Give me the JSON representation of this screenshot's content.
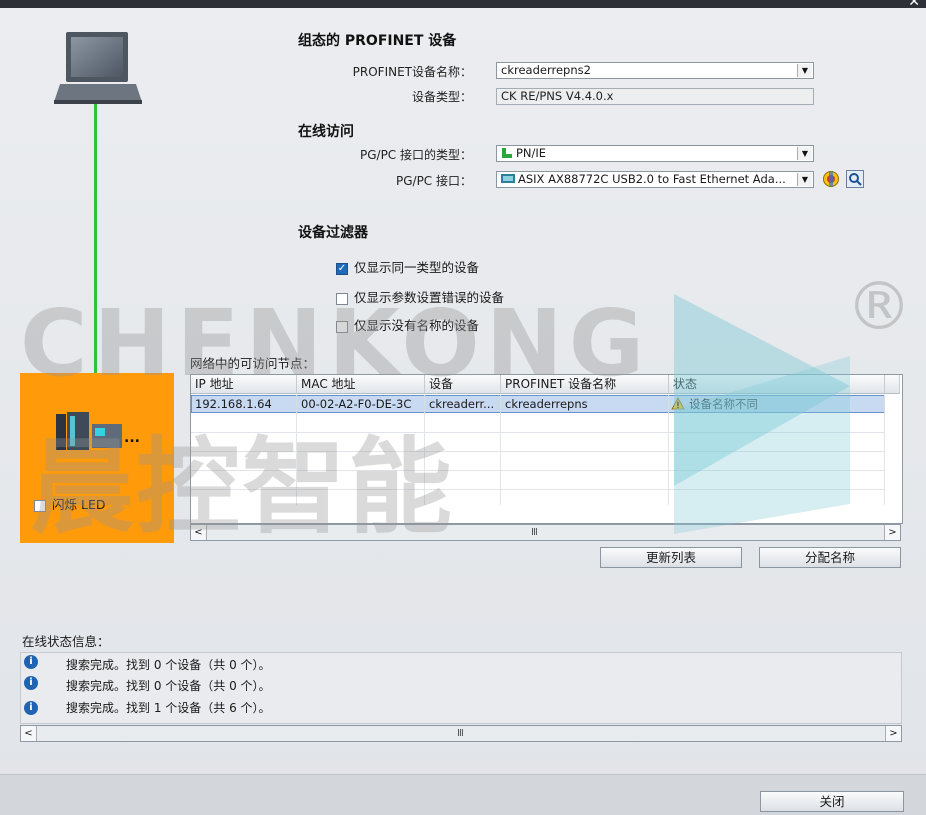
{
  "window": {
    "close_glyph": "✕"
  },
  "configured_device": {
    "heading": "组态的 PROFINET 设备",
    "name_label": "PROFINET设备名称：",
    "name_value": "ckreaderrepns2",
    "type_label": "设备类型：",
    "type_value": "CK RE/PNS V4.4.0.x"
  },
  "online_access": {
    "heading": "在线访问",
    "pgpc_type_label": "PG/PC 接口的类型：",
    "pgpc_type_value": "PN/IE",
    "pgpc_iface_label": "PG/PC 接口：",
    "pgpc_iface_value": "ASIX AX88772C USB2.0 to Fast Ethernet Ada..."
  },
  "filter": {
    "heading": "设备过滤器",
    "options": [
      {
        "label": "仅显示同一类型的设备",
        "checked": true
      },
      {
        "label": "仅显示参数设置错误的设备",
        "checked": false
      },
      {
        "label": "仅显示没有名称的设备",
        "checked": false
      }
    ]
  },
  "nodes": {
    "caption": "网络中的可访问节点：",
    "columns": [
      "IP 地址",
      "MAC 地址",
      "设备",
      "PROFINET 设备名称",
      "状态"
    ],
    "rows": [
      [
        "192.168.1.64",
        "00-02-A2-F0-DE-3C",
        "ckreaderr...",
        "ckreaderrepns",
        "设备名称不同"
      ]
    ],
    "scroll_mid": "Ⅲ"
  },
  "buttons": {
    "update_list": "更新列表",
    "assign_name": "分配名称",
    "close": "关闭"
  },
  "left_panel": {
    "flash_led": "闪烁 LED",
    "ellipsis": "..."
  },
  "status": {
    "caption": "在线状态信息：",
    "messages": [
      "搜索完成。找到 0 个设备（共 0 个）。",
      "搜索完成。找到 0 个设备（共 0 个）。",
      "搜索完成。找到 1 个设备（共 6 个）。"
    ],
    "scroll_mid": "Ⅲ"
  },
  "watermark": {
    "text_en": "CHENKONG",
    "text_cn": "晨控智能",
    "reg": "®"
  },
  "colors": {
    "orange": "#ff9a0a",
    "link_green": "#30c23a",
    "selection": "#c8d9f2",
    "watermark_teal": "#7ec9d8"
  }
}
